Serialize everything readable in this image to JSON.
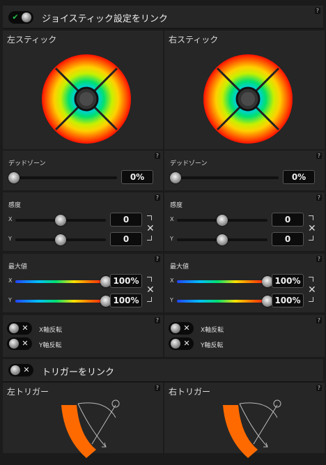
{
  "link_sticks": {
    "label": "ジョイスティック設定をリンク",
    "checked": true,
    "check_glyph": "✔"
  },
  "help_glyph": "?",
  "x_glyph": "✕",
  "sticks": [
    {
      "title": "左スティック",
      "deadzone": {
        "label": "デッドゾーン",
        "value": "0%",
        "level": 0
      },
      "sensitivity": {
        "label": "感度",
        "x_axis": "X",
        "y_axis": "Y",
        "x_value": "0",
        "y_value": "0",
        "x_level": 0.5,
        "y_level": 0.5
      },
      "max": {
        "label": "最大値",
        "x_axis": "X",
        "y_axis": "Y",
        "x_value": "100%",
        "y_value": "100%",
        "x_level": 1.0,
        "y_level": 1.0
      },
      "invert": {
        "x_label": "X軸反転",
        "y_label": "Y軸反転"
      }
    },
    {
      "title": "右スティック",
      "deadzone": {
        "label": "デッドゾーン",
        "value": "0%",
        "level": 0
      },
      "sensitivity": {
        "label": "感度",
        "x_axis": "X",
        "y_axis": "Y",
        "x_value": "0",
        "y_value": "0",
        "x_level": 0.5,
        "y_level": 0.5
      },
      "max": {
        "label": "最大値",
        "x_axis": "X",
        "y_axis": "Y",
        "x_value": "100%",
        "y_value": "100%",
        "x_level": 1.0,
        "y_level": 1.0
      },
      "invert": {
        "x_label": "X軸反転",
        "y_label": "Y軸反転"
      }
    }
  ],
  "link_triggers": {
    "label": "トリガーをリンク",
    "checked": false
  },
  "triggers": [
    {
      "title": "左トリガー",
      "icon": "trigger-arc-icon"
    },
    {
      "title": "右トリガー",
      "icon": "trigger-arc-icon"
    }
  ],
  "colors": {
    "check_green": "#22c24a",
    "trigger_orange": "#ff6a00",
    "accent_red": "#ff1a1a"
  }
}
